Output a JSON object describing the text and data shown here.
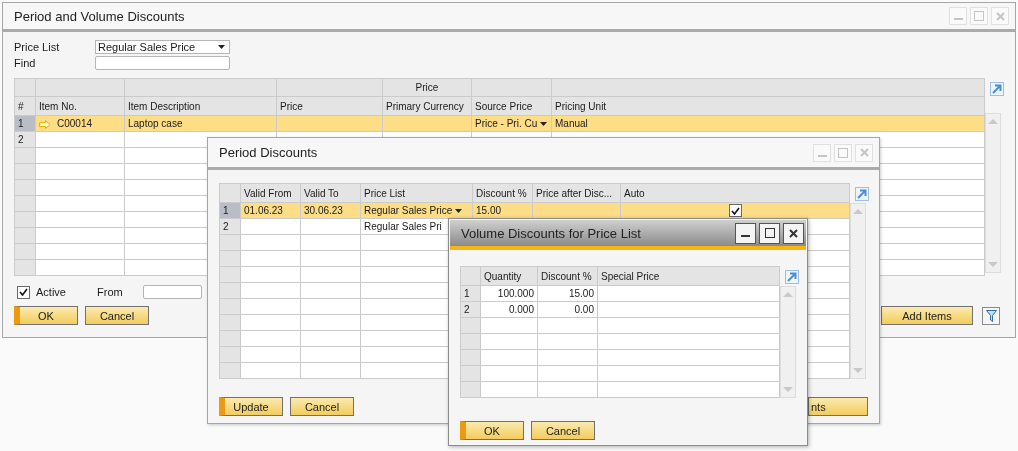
{
  "main_window": {
    "title": "Period and Volume Discounts",
    "active": false,
    "price_list": {
      "label": "Price List",
      "value": "Regular Sales Price"
    },
    "find": {
      "label": "Find"
    },
    "table": {
      "number_header": "#",
      "columns": [
        {
          "label": "Item No."
        },
        {
          "label": "Item Description"
        },
        {
          "label": "Price"
        },
        {
          "label": "Primary Currency",
          "group": "Price"
        },
        {
          "label": "Source Price"
        },
        {
          "label": "Pricing Unit"
        }
      ],
      "rows": [
        {
          "number": "1",
          "selected": true,
          "cells": [
            {
              "kind": "link",
              "text": "C00014"
            },
            {
              "text": "Laptop case"
            },
            {},
            {},
            {
              "kind": "dropdown",
              "text": "Price - Pri. Cu"
            },
            {
              "text": "Manual"
            }
          ]
        },
        {
          "number": "2",
          "selected": false,
          "cells": []
        }
      ]
    },
    "active_checkbox": {
      "label": "Active",
      "checked": true
    },
    "from": {
      "label": "From"
    },
    "buttons": [
      {
        "label": "OK",
        "default": true
      },
      {
        "label": "Cancel",
        "default": false
      }
    ],
    "right_buttons": [
      {
        "kind": "text",
        "label": "Add Items"
      },
      {
        "kind": "filter"
      }
    ]
  },
  "period_discounts_window": {
    "title": "Period Discounts",
    "active": false,
    "table": {
      "columns": [
        {
          "label": "Valid From"
        },
        {
          "label": "Valid To"
        },
        {
          "label": "Price List"
        },
        {
          "label": "Discount %"
        },
        {
          "label": "Price after Disc..."
        },
        {
          "label": "Auto"
        }
      ],
      "rows": [
        {
          "number": "1",
          "selected": true,
          "cells": [
            {
              "text": "01.06.23"
            },
            {
              "text": "30.06.23"
            },
            {
              "kind": "dropdown",
              "text": "Regular Sales Price"
            },
            {
              "text": "15.00"
            },
            {},
            {
              "kind": "checkbox",
              "checked": true
            }
          ]
        },
        {
          "number": "2",
          "selected": false,
          "cells": [
            {},
            {},
            {
              "text": "Regular Sales Pri"
            }
          ]
        }
      ]
    },
    "buttons": [
      {
        "label": "Update",
        "default": true
      },
      {
        "label": "Cancel",
        "default": false
      }
    ],
    "right_buttons": [
      {
        "label": "nts"
      }
    ]
  },
  "volume_discounts_window": {
    "title": "Volume Discounts for Price List",
    "active": true,
    "table": {
      "columns": [
        {
          "label": "Quantity"
        },
        {
          "label": "Discount %"
        },
        {
          "label": "Special Price"
        }
      ],
      "rows": [
        {
          "number": "1",
          "selected": false,
          "cells": [
            {
              "text": "100.000"
            },
            {
              "text": "15.00"
            },
            {}
          ]
        },
        {
          "number": "2",
          "selected": false,
          "cells": [
            {
              "text": "0.000"
            },
            {
              "text": "0.00"
            },
            {}
          ]
        }
      ]
    },
    "buttons": [
      {
        "label": "OK",
        "default": true
      },
      {
        "label": "Cancel",
        "default": false
      }
    ]
  }
}
